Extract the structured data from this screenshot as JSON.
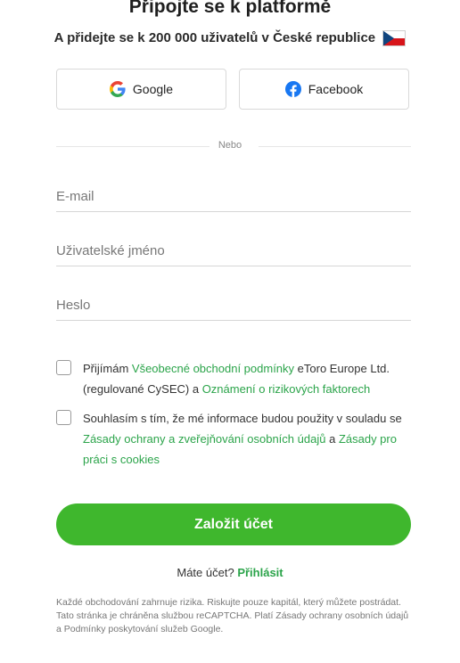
{
  "header": {
    "title": "Připojte se k platformě",
    "subtitle": "A přidejte se k 200 000 uživatelů v České republice"
  },
  "social": {
    "google_label": "Google",
    "facebook_label": "Facebook",
    "google_icon": "google-g-icon",
    "facebook_icon": "facebook-f-icon",
    "facebook_color": "#1877f2"
  },
  "separator": {
    "label": "Nebo"
  },
  "form": {
    "email_placeholder": "E-mail",
    "username_placeholder": "Uživatelské jméno",
    "password_placeholder": "Heslo"
  },
  "consents": {
    "terms": {
      "prefix": "Přijímám",
      "link1": "Všeobecné obchodní podmínky",
      "middle": "eToro Europe Ltd. (regulované CySEC) a",
      "link2": "Oznámení o rizikových faktorech"
    },
    "privacy": {
      "prefix": "Souhlasím s tím, že mé informace budou použity v souladu se",
      "link1": "Zásady ochrany a zveřejňování osobních údajů",
      "middle": "a",
      "link2": "Zásady pro práci s cookies"
    }
  },
  "submit_label": "Založit účet",
  "login": {
    "question": "Máte účet?",
    "link": "Přihlásit"
  },
  "disclaimer": "Každé obchodování zahrnuje rizika. Riskujte pouze kapitál, který můžete postrádat.  Tato stránka je chráněna službou reCAPTCHA. Platí Zásady ochrany osobních údajů a Podmínky poskytování služeb Google.",
  "colors": {
    "accent_green": "#3fb72d",
    "link_green": "#2ba44a"
  }
}
